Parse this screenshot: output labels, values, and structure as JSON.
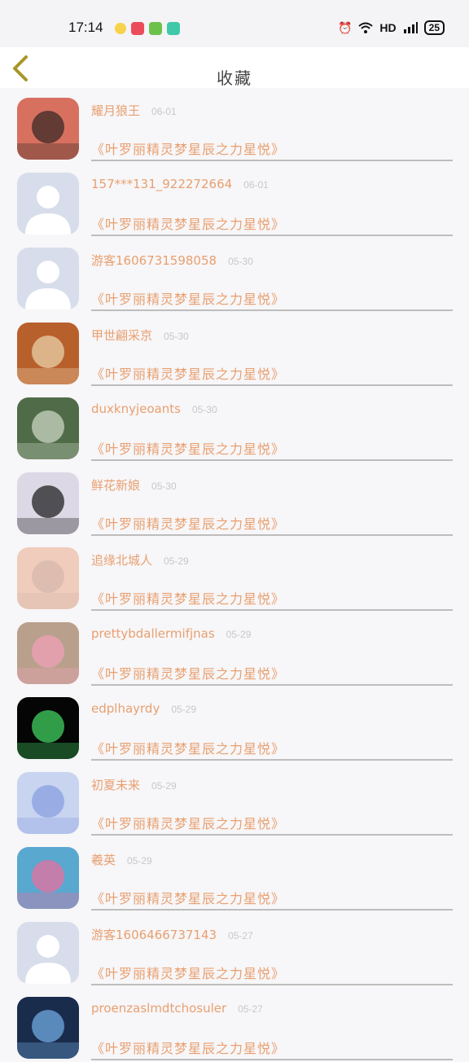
{
  "status": {
    "time": "17:14",
    "network": "HD",
    "battery": "25"
  },
  "header": {
    "title": "收藏"
  },
  "novel_title": "《叶罗丽精灵梦星辰之力星悦》",
  "items": [
    {
      "name": "耀月狼王",
      "date": "06-01",
      "avatar": "photo-boy-icon",
      "colors": [
        "#d87060",
        "#3a2a26"
      ]
    },
    {
      "name": "157***131_922272664",
      "date": "06-01",
      "avatar": "default-user-icon",
      "colors": [
        "#d7ddeb",
        "#ffffff"
      ]
    },
    {
      "name": "游客1606731598058",
      "date": "05-30",
      "avatar": "default-user-icon",
      "colors": [
        "#d7ddeb",
        "#ffffff"
      ]
    },
    {
      "name": "甲世翩采京",
      "date": "05-30",
      "avatar": "alarm-clock-bear-icon",
      "colors": [
        "#b8602c",
        "#ead0a8"
      ]
    },
    {
      "name": "duxknyjeoants",
      "date": "05-30",
      "avatar": "window-plants-icon",
      "colors": [
        "#4f6b48",
        "#c9d4c0"
      ]
    },
    {
      "name": "鲜花新娘",
      "date": "05-30",
      "avatar": "girl-portrait-icon",
      "colors": [
        "#dcd8e6",
        "#222"
      ]
    },
    {
      "name": "追缘北城人",
      "date": "05-29",
      "avatar": "selfie-girl-icon",
      "colors": [
        "#f0ccbc",
        "#d8b8ad"
      ]
    },
    {
      "name": "prettybdallermifjnas",
      "date": "05-29",
      "avatar": "shoes-icon",
      "colors": [
        "#b8a08c",
        "#f0a0b8"
      ]
    },
    {
      "name": "edplhayrdy",
      "date": "05-29",
      "avatar": "skull-art-icon",
      "colors": [
        "#050505",
        "#40d060"
      ]
    },
    {
      "name": "初夏未来",
      "date": "05-29",
      "avatar": "anime-girl-blue-icon",
      "colors": [
        "#c8d4f0",
        "#8aa0e0"
      ]
    },
    {
      "name": "羲英",
      "date": "05-29",
      "avatar": "anime-girl-colorful-icon",
      "colors": [
        "#58a8d0",
        "#e870a0"
      ]
    },
    {
      "name": "游客1606466737143",
      "date": "05-27",
      "avatar": "default-user-icon",
      "colors": [
        "#d7ddeb",
        "#ffffff"
      ]
    },
    {
      "name": "proenzaslmdtchosuler",
      "date": "05-27",
      "avatar": "city-night-icon",
      "colors": [
        "#1a2c4c",
        "#70a8e0"
      ]
    }
  ]
}
